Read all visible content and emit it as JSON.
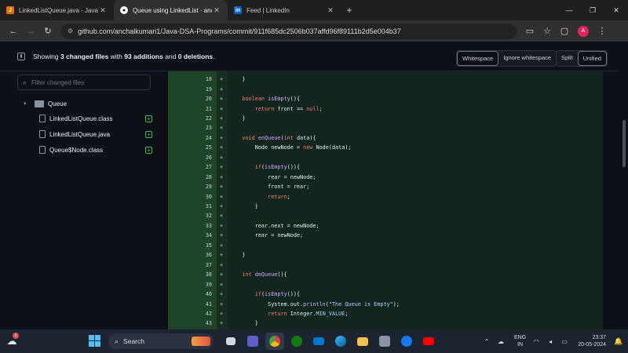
{
  "browser": {
    "tabs": [
      {
        "title": "LinkedListQueue.java - Java-DSA",
        "favicon": "java-file-icon",
        "active": false
      },
      {
        "title": "Queue using LinkedList · anchalk",
        "favicon": "github-icon",
        "active": true
      },
      {
        "title": "Feed | LinkedIn",
        "favicon": "linkedin-icon",
        "active": false
      }
    ],
    "new_tab": "+",
    "url": "github.com/anchalkumari1/Java-DSA-Programs/commit/911f685dc2506b037affd96f89111b2d5e004b37"
  },
  "diff": {
    "summary_prefix": "Showing ",
    "files_changed": "3 changed files",
    "summary_mid": " with ",
    "additions": "93 additions",
    "summary_and": " and ",
    "deletions": "0 deletions",
    "summary_end": ".",
    "whitespace_buttons": [
      "Whitespace",
      "Ignore whitespace"
    ],
    "view_buttons": [
      "Split",
      "Unified"
    ],
    "filter_placeholder": "Filter changed files",
    "folder": "Queue",
    "files": [
      "LinkedListQueue.class",
      "LinkedListQueue.java",
      "Queue$Node.class"
    ],
    "add_marker": "+"
  },
  "code_lines": [
    {
      "n": "18",
      "t": "    }"
    },
    {
      "n": "19",
      "t": ""
    },
    {
      "n": "20",
      "t": "    boolean isEmpty(){"
    },
    {
      "n": "21",
      "t": "        return front == null;"
    },
    {
      "n": "22",
      "t": "    }"
    },
    {
      "n": "23",
      "t": ""
    },
    {
      "n": "24",
      "t": "    void enQueue(int data){"
    },
    {
      "n": "25",
      "t": "        Node newNode = new Node(data);"
    },
    {
      "n": "26",
      "t": ""
    },
    {
      "n": "27",
      "t": "        if(isEmpty()){"
    },
    {
      "n": "28",
      "t": "            rear = newNode;"
    },
    {
      "n": "29",
      "t": "            front = rear;"
    },
    {
      "n": "30",
      "t": "            return;"
    },
    {
      "n": "31",
      "t": "        }"
    },
    {
      "n": "32",
      "t": ""
    },
    {
      "n": "33",
      "t": "        rear.next = newNode;"
    },
    {
      "n": "34",
      "t": "        rear = newNode;"
    },
    {
      "n": "35",
      "t": ""
    },
    {
      "n": "36",
      "t": "    }"
    },
    {
      "n": "37",
      "t": ""
    },
    {
      "n": "38",
      "t": "    int deQueue(){"
    },
    {
      "n": "39",
      "t": ""
    },
    {
      "n": "40",
      "t": "        if(isEmpty()){"
    },
    {
      "n": "41",
      "t": "            System.out.println(\"The Queue is Empty\");"
    },
    {
      "n": "42",
      "t": "            return Integer.MIN_VALUE;"
    },
    {
      "n": "43",
      "t": "        }"
    }
  ],
  "taskbar": {
    "search": "Search",
    "weather_badge": "1",
    "lang_top": "ENG",
    "lang_bottom": "IN",
    "time": "23:37",
    "date": "20-05-2024"
  },
  "colors": {
    "addition_bg": "#12261e",
    "addition_gutter": "#1d4428",
    "accent_green": "#3fb950",
    "profile": "#e0245e"
  }
}
